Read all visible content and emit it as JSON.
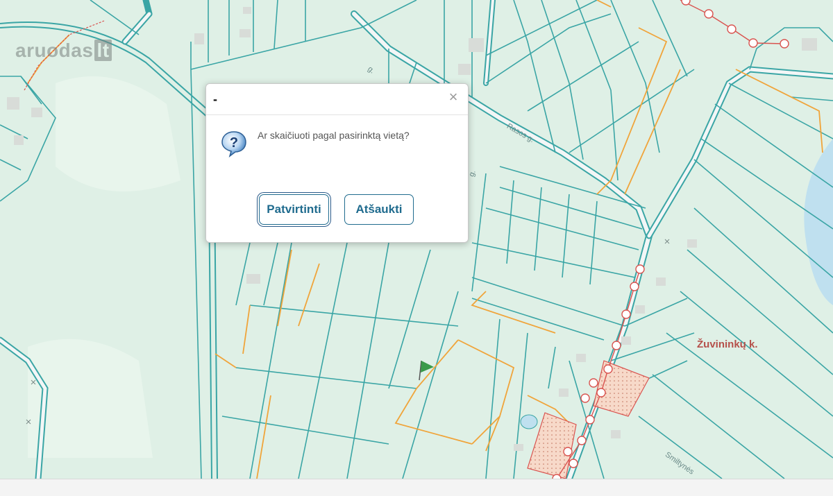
{
  "watermark": {
    "brand": "aruodas",
    "tld": "lt"
  },
  "map": {
    "village_label": "Žuvininkų k.",
    "street_labels": [
      "Rasos g.",
      "g.",
      "g.",
      "Smiltynės"
    ]
  },
  "dialog": {
    "title": "-",
    "close_symbol": "×",
    "message": "Ar skaičiuoti pagal pasirinktą vietą?",
    "icon": "question-icon",
    "confirm_label": "Patvirtinti",
    "cancel_label": "Atšaukti"
  },
  "colors": {
    "map_background": "#dff0e6",
    "parcel_line": "#3aa5a5",
    "road_fill": "#f3f6f6",
    "orange_boundary": "#f0a43a",
    "red_marker": "#d9534f",
    "button_text": "#1f6b8e",
    "water": "#bfe0ef"
  }
}
